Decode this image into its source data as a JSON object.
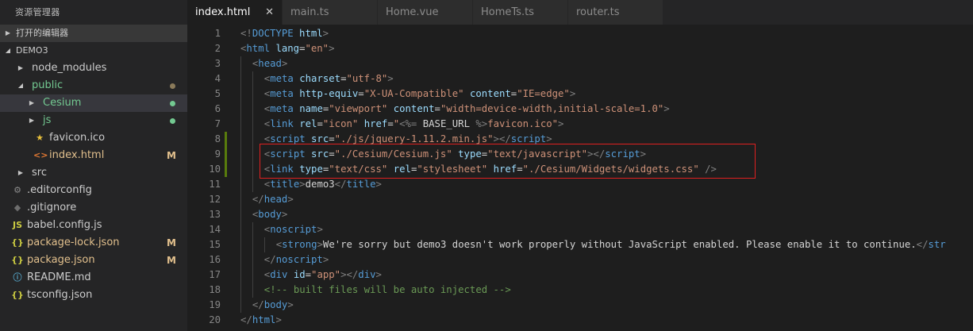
{
  "sidebar": {
    "title": "资源管理器",
    "open_editors_label": "打开的编辑器",
    "workspace_label": "DEMO3",
    "items": [
      {
        "name": "node_modules",
        "type": "folder",
        "indent": 1,
        "color": "#cccccc"
      },
      {
        "name": "public",
        "type": "folder-open",
        "indent": 1,
        "color": "#73c991",
        "dot": "#8a7a5a"
      },
      {
        "name": "Cesium",
        "type": "folder",
        "indent": 2,
        "color": "#73c991",
        "dot": "#73c991",
        "selected": true
      },
      {
        "name": "js",
        "type": "folder",
        "indent": 2,
        "color": "#73c991",
        "dot": "#73c991"
      },
      {
        "name": "favicon.ico",
        "type": "star",
        "indent": 2,
        "color": "#cccccc"
      },
      {
        "name": "index.html",
        "type": "html",
        "indent": 2,
        "color": "#e2c08d",
        "badge": "M"
      },
      {
        "name": "src",
        "type": "folder",
        "indent": 1,
        "color": "#cccccc"
      },
      {
        "name": ".editorconfig",
        "type": "gear",
        "indent": 0,
        "color": "#cccccc"
      },
      {
        "name": ".gitignore",
        "type": "git",
        "indent": 0,
        "color": "#cccccc"
      },
      {
        "name": "babel.config.js",
        "type": "js",
        "indent": 0,
        "color": "#cccccc"
      },
      {
        "name": "package-lock.json",
        "type": "json",
        "indent": 0,
        "color": "#e2c08d",
        "badge": "M"
      },
      {
        "name": "package.json",
        "type": "json",
        "indent": 0,
        "color": "#e2c08d",
        "badge": "M"
      },
      {
        "name": "README.md",
        "type": "info",
        "indent": 0,
        "color": "#cccccc"
      },
      {
        "name": "tsconfig.json",
        "type": "json",
        "indent": 0,
        "color": "#cccccc"
      }
    ]
  },
  "tabs": [
    {
      "label": "index.html",
      "active": true,
      "close": "✕"
    },
    {
      "label": "main.ts",
      "active": false
    },
    {
      "label": "Home.vue",
      "active": false
    },
    {
      "label": "HomeTs.ts",
      "active": false
    },
    {
      "label": "router.ts",
      "active": false
    }
  ],
  "editor": {
    "lines": [
      {
        "n": "1",
        "indent": 0,
        "tokens": [
          [
            "br",
            "<!"
          ],
          [
            "tag",
            "DOCTYPE"
          ],
          [
            "txt",
            " "
          ],
          [
            "attr",
            "html"
          ],
          [
            "br",
            ">"
          ]
        ]
      },
      {
        "n": "2",
        "indent": 0,
        "tokens": [
          [
            "br",
            "<"
          ],
          [
            "tag",
            "html"
          ],
          [
            "txt",
            " "
          ],
          [
            "attr",
            "lang"
          ],
          [
            "txt",
            "="
          ],
          [
            "str",
            "\"en\""
          ],
          [
            "br",
            ">"
          ]
        ]
      },
      {
        "n": "3",
        "indent": 1,
        "tokens": [
          [
            "br",
            "<"
          ],
          [
            "tag",
            "head"
          ],
          [
            "br",
            ">"
          ]
        ]
      },
      {
        "n": "4",
        "indent": 2,
        "tokens": [
          [
            "br",
            "<"
          ],
          [
            "tag",
            "meta"
          ],
          [
            "txt",
            " "
          ],
          [
            "attr",
            "charset"
          ],
          [
            "txt",
            "="
          ],
          [
            "str",
            "\"utf-8\""
          ],
          [
            "br",
            ">"
          ]
        ]
      },
      {
        "n": "5",
        "indent": 2,
        "tokens": [
          [
            "br",
            "<"
          ],
          [
            "tag",
            "meta"
          ],
          [
            "txt",
            " "
          ],
          [
            "attr",
            "http-equiv"
          ],
          [
            "txt",
            "="
          ],
          [
            "str",
            "\"X-UA-Compatible\""
          ],
          [
            "txt",
            " "
          ],
          [
            "attr",
            "content"
          ],
          [
            "txt",
            "="
          ],
          [
            "str",
            "\"IE=edge\""
          ],
          [
            "br",
            ">"
          ]
        ]
      },
      {
        "n": "6",
        "indent": 2,
        "tokens": [
          [
            "br",
            "<"
          ],
          [
            "tag",
            "meta"
          ],
          [
            "txt",
            " "
          ],
          [
            "attr",
            "name"
          ],
          [
            "txt",
            "="
          ],
          [
            "str",
            "\"viewport\""
          ],
          [
            "txt",
            " "
          ],
          [
            "attr",
            "content"
          ],
          [
            "txt",
            "="
          ],
          [
            "str",
            "\"width=device-width,initial-scale=1.0\""
          ],
          [
            "br",
            ">"
          ]
        ]
      },
      {
        "n": "7",
        "indent": 2,
        "tokens": [
          [
            "br",
            "<"
          ],
          [
            "tag",
            "link"
          ],
          [
            "txt",
            " "
          ],
          [
            "attr",
            "rel"
          ],
          [
            "txt",
            "="
          ],
          [
            "str",
            "\"icon\""
          ],
          [
            "txt",
            " "
          ],
          [
            "attr",
            "href"
          ],
          [
            "txt",
            "="
          ],
          [
            "str",
            "\""
          ],
          [
            "br",
            "<%="
          ],
          [
            "txt",
            " BASE_URL "
          ],
          [
            "br",
            "%>"
          ],
          [
            "str",
            "favicon.ico\""
          ],
          [
            "br",
            ">"
          ]
        ]
      },
      {
        "n": "8",
        "indent": 2,
        "mark": true,
        "tokens": [
          [
            "br",
            "<"
          ],
          [
            "tag",
            "script"
          ],
          [
            "txt",
            " "
          ],
          [
            "attr",
            "src"
          ],
          [
            "txt",
            "="
          ],
          [
            "str",
            "\"./js/jquery-1.11.2.min.js\""
          ],
          [
            "br",
            "></"
          ],
          [
            "tag",
            "script"
          ],
          [
            "br",
            ">"
          ]
        ]
      },
      {
        "n": "9",
        "indent": 2,
        "mark": true,
        "tokens": [
          [
            "br",
            "<"
          ],
          [
            "tag",
            "script"
          ],
          [
            "txt",
            " "
          ],
          [
            "attr",
            "src"
          ],
          [
            "txt",
            "="
          ],
          [
            "str",
            "\"./Cesium/Cesium.js\""
          ],
          [
            "txt",
            " "
          ],
          [
            "attr",
            "type"
          ],
          [
            "txt",
            "="
          ],
          [
            "str",
            "\"text/javascript\""
          ],
          [
            "br",
            "></"
          ],
          [
            "tag",
            "script"
          ],
          [
            "br",
            ">"
          ]
        ]
      },
      {
        "n": "10",
        "indent": 2,
        "mark": true,
        "tokens": [
          [
            "br",
            "<"
          ],
          [
            "tag",
            "link"
          ],
          [
            "txt",
            " "
          ],
          [
            "attr",
            "type"
          ],
          [
            "txt",
            "="
          ],
          [
            "str",
            "\"text/css\""
          ],
          [
            "txt",
            " "
          ],
          [
            "attr",
            "rel"
          ],
          [
            "txt",
            "="
          ],
          [
            "str",
            "\"stylesheet\""
          ],
          [
            "txt",
            " "
          ],
          [
            "attr",
            "href"
          ],
          [
            "txt",
            "="
          ],
          [
            "str",
            "\"./Cesium/Widgets/widgets.css\""
          ],
          [
            "txt",
            " "
          ],
          [
            "br",
            "/>"
          ]
        ]
      },
      {
        "n": "11",
        "indent": 2,
        "tokens": [
          [
            "br",
            "<"
          ],
          [
            "tag",
            "title"
          ],
          [
            "br",
            ">"
          ],
          [
            "txt",
            "demo3"
          ],
          [
            "br",
            "</"
          ],
          [
            "tag",
            "title"
          ],
          [
            "br",
            ">"
          ]
        ]
      },
      {
        "n": "12",
        "indent": 1,
        "tokens": [
          [
            "br",
            "</"
          ],
          [
            "tag",
            "head"
          ],
          [
            "br",
            ">"
          ]
        ]
      },
      {
        "n": "13",
        "indent": 1,
        "tokens": [
          [
            "br",
            "<"
          ],
          [
            "tag",
            "body"
          ],
          [
            "br",
            ">"
          ]
        ]
      },
      {
        "n": "14",
        "indent": 2,
        "tokens": [
          [
            "br",
            "<"
          ],
          [
            "tag",
            "noscript"
          ],
          [
            "br",
            ">"
          ]
        ]
      },
      {
        "n": "15",
        "indent": 3,
        "tokens": [
          [
            "br",
            "<"
          ],
          [
            "tag",
            "strong"
          ],
          [
            "br",
            ">"
          ],
          [
            "txt",
            "We're sorry but demo3 doesn't work properly without JavaScript enabled. Please enable it to continue."
          ],
          [
            "br",
            "</"
          ],
          [
            "tag",
            "str"
          ]
        ]
      },
      {
        "n": "16",
        "indent": 2,
        "tokens": [
          [
            "br",
            "</"
          ],
          [
            "tag",
            "noscript"
          ],
          [
            "br",
            ">"
          ]
        ]
      },
      {
        "n": "17",
        "indent": 2,
        "tokens": [
          [
            "br",
            "<"
          ],
          [
            "tag",
            "div"
          ],
          [
            "txt",
            " "
          ],
          [
            "attr",
            "id"
          ],
          [
            "txt",
            "="
          ],
          [
            "str",
            "\"app\""
          ],
          [
            "br",
            "></"
          ],
          [
            "tag",
            "div"
          ],
          [
            "br",
            ">"
          ]
        ]
      },
      {
        "n": "18",
        "indent": 2,
        "tokens": [
          [
            "com",
            "<!-- built files will be auto injected -->"
          ]
        ]
      },
      {
        "n": "19",
        "indent": 1,
        "tokens": [
          [
            "br",
            "</"
          ],
          [
            "tag",
            "body"
          ],
          [
            "br",
            ">"
          ]
        ]
      },
      {
        "n": "20",
        "indent": 0,
        "tokens": [
          [
            "br",
            "</"
          ],
          [
            "tag",
            "html"
          ],
          [
            "br",
            ">"
          ]
        ]
      }
    ]
  }
}
